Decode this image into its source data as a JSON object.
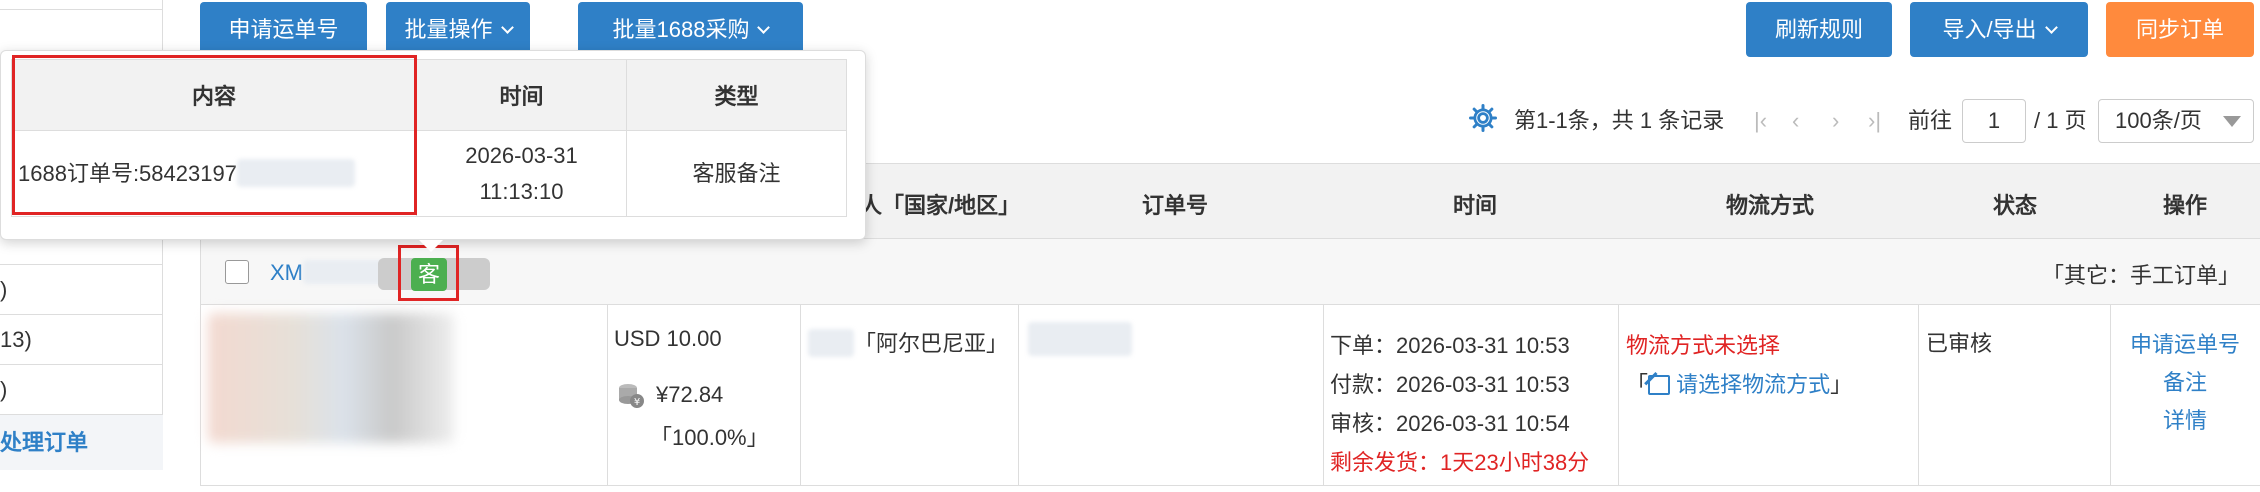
{
  "toolbar": {
    "apply_waybill": "申请运单号",
    "batch_ops": "批量操作",
    "batch_1688": "批量1688采购",
    "refresh_rules": "刷新规则",
    "import_export": "导入/导出",
    "sync_orders": "同步订单"
  },
  "sidebar": {
    "rows": [
      ")",
      "13)",
      ")"
    ],
    "process_link": "处理订单"
  },
  "popover": {
    "headers": [
      "内容",
      "时间",
      "类型"
    ],
    "content": "1688订单号:58423197",
    "time": "2026-03-31 11:13:10",
    "type": "客服备注"
  },
  "pagination": {
    "summary": "第1-1条，共 1 条记录",
    "goto_label": "前往",
    "page_value": "1",
    "total_pages": "/ 1 页",
    "page_size": "100条/页"
  },
  "table": {
    "headers": {
      "country": "人「国家/地区」",
      "order_no": "订单号",
      "time": "时间",
      "logistics": "物流方式",
      "status": "状态",
      "actions": "操作"
    },
    "group": {
      "order_prefix": "XM",
      "badge": "客",
      "tag": "「其它：手工订单」"
    },
    "row": {
      "amount": "USD 10.00",
      "cost": "¥72.84",
      "ratio": "「100.0%」",
      "country": "「阿尔巴尼亚」",
      "time_order": "下单：2026-03-31 10:53",
      "time_paid": "付款：2026-03-31 10:53",
      "time_audit": "审核：2026-03-31 10:54",
      "time_remaining": "剩余发货：1天23小时38分",
      "logistics_unselected": "物流方式未选择",
      "logistics_choose": "请选择物流方式",
      "status": "已审核",
      "action_waybill": "申请运单号",
      "action_note": "备注",
      "action_detail": "详情"
    }
  },
  "colors": {
    "primary": "#2f80c7",
    "orange": "#ff8a3d",
    "red": "#e02424",
    "green_badge": "#4caf50"
  }
}
